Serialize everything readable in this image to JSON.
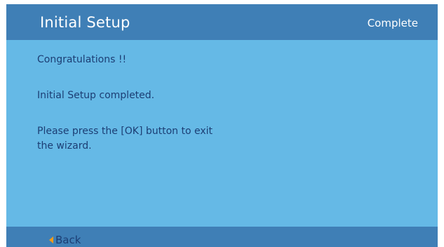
{
  "header": {
    "title": "Initial Setup",
    "status": "Complete"
  },
  "content": {
    "congrats": "Congratulations !!",
    "completed": "Initial Setup completed.",
    "instructions": "Please press the [OK] button to exit the wizard."
  },
  "footer": {
    "back_label": "Back",
    "back_icon": "left-triangle-arrow"
  },
  "colors": {
    "background": "#65b9e6",
    "header_bar": "#3f7fb6",
    "text_dark": "#1c3e74",
    "text_light": "#ffffff",
    "arrow": "#f29b1a"
  }
}
